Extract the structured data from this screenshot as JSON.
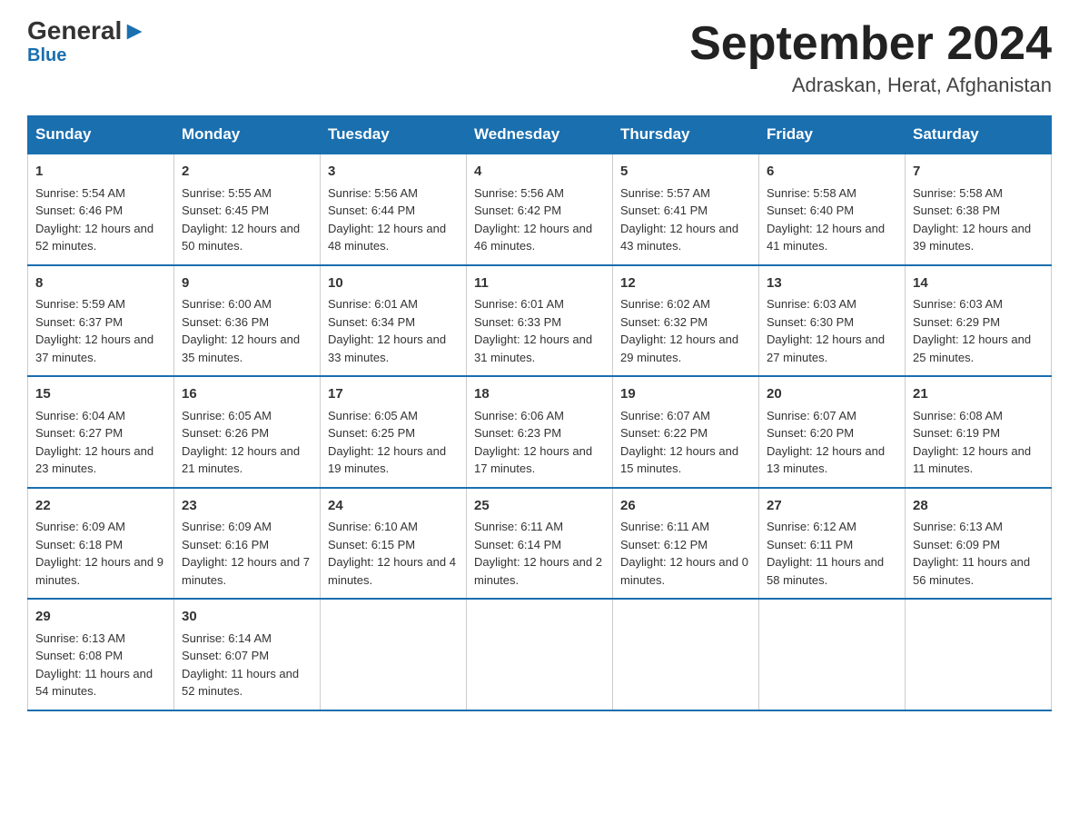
{
  "header": {
    "logo_line1_black": "General",
    "logo_line1_blue": "Blue",
    "month_title": "September 2024",
    "location": "Adraskan, Herat, Afghanistan"
  },
  "days_of_week": [
    "Sunday",
    "Monday",
    "Tuesday",
    "Wednesday",
    "Thursday",
    "Friday",
    "Saturday"
  ],
  "weeks": [
    [
      {
        "day": "1",
        "sunrise": "Sunrise: 5:54 AM",
        "sunset": "Sunset: 6:46 PM",
        "daylight": "Daylight: 12 hours and 52 minutes."
      },
      {
        "day": "2",
        "sunrise": "Sunrise: 5:55 AM",
        "sunset": "Sunset: 6:45 PM",
        "daylight": "Daylight: 12 hours and 50 minutes."
      },
      {
        "day": "3",
        "sunrise": "Sunrise: 5:56 AM",
        "sunset": "Sunset: 6:44 PM",
        "daylight": "Daylight: 12 hours and 48 minutes."
      },
      {
        "day": "4",
        "sunrise": "Sunrise: 5:56 AM",
        "sunset": "Sunset: 6:42 PM",
        "daylight": "Daylight: 12 hours and 46 minutes."
      },
      {
        "day": "5",
        "sunrise": "Sunrise: 5:57 AM",
        "sunset": "Sunset: 6:41 PM",
        "daylight": "Daylight: 12 hours and 43 minutes."
      },
      {
        "day": "6",
        "sunrise": "Sunrise: 5:58 AM",
        "sunset": "Sunset: 6:40 PM",
        "daylight": "Daylight: 12 hours and 41 minutes."
      },
      {
        "day": "7",
        "sunrise": "Sunrise: 5:58 AM",
        "sunset": "Sunset: 6:38 PM",
        "daylight": "Daylight: 12 hours and 39 minutes."
      }
    ],
    [
      {
        "day": "8",
        "sunrise": "Sunrise: 5:59 AM",
        "sunset": "Sunset: 6:37 PM",
        "daylight": "Daylight: 12 hours and 37 minutes."
      },
      {
        "day": "9",
        "sunrise": "Sunrise: 6:00 AM",
        "sunset": "Sunset: 6:36 PM",
        "daylight": "Daylight: 12 hours and 35 minutes."
      },
      {
        "day": "10",
        "sunrise": "Sunrise: 6:01 AM",
        "sunset": "Sunset: 6:34 PM",
        "daylight": "Daylight: 12 hours and 33 minutes."
      },
      {
        "day": "11",
        "sunrise": "Sunrise: 6:01 AM",
        "sunset": "Sunset: 6:33 PM",
        "daylight": "Daylight: 12 hours and 31 minutes."
      },
      {
        "day": "12",
        "sunrise": "Sunrise: 6:02 AM",
        "sunset": "Sunset: 6:32 PM",
        "daylight": "Daylight: 12 hours and 29 minutes."
      },
      {
        "day": "13",
        "sunrise": "Sunrise: 6:03 AM",
        "sunset": "Sunset: 6:30 PM",
        "daylight": "Daylight: 12 hours and 27 minutes."
      },
      {
        "day": "14",
        "sunrise": "Sunrise: 6:03 AM",
        "sunset": "Sunset: 6:29 PM",
        "daylight": "Daylight: 12 hours and 25 minutes."
      }
    ],
    [
      {
        "day": "15",
        "sunrise": "Sunrise: 6:04 AM",
        "sunset": "Sunset: 6:27 PM",
        "daylight": "Daylight: 12 hours and 23 minutes."
      },
      {
        "day": "16",
        "sunrise": "Sunrise: 6:05 AM",
        "sunset": "Sunset: 6:26 PM",
        "daylight": "Daylight: 12 hours and 21 minutes."
      },
      {
        "day": "17",
        "sunrise": "Sunrise: 6:05 AM",
        "sunset": "Sunset: 6:25 PM",
        "daylight": "Daylight: 12 hours and 19 minutes."
      },
      {
        "day": "18",
        "sunrise": "Sunrise: 6:06 AM",
        "sunset": "Sunset: 6:23 PM",
        "daylight": "Daylight: 12 hours and 17 minutes."
      },
      {
        "day": "19",
        "sunrise": "Sunrise: 6:07 AM",
        "sunset": "Sunset: 6:22 PM",
        "daylight": "Daylight: 12 hours and 15 minutes."
      },
      {
        "day": "20",
        "sunrise": "Sunrise: 6:07 AM",
        "sunset": "Sunset: 6:20 PM",
        "daylight": "Daylight: 12 hours and 13 minutes."
      },
      {
        "day": "21",
        "sunrise": "Sunrise: 6:08 AM",
        "sunset": "Sunset: 6:19 PM",
        "daylight": "Daylight: 12 hours and 11 minutes."
      }
    ],
    [
      {
        "day": "22",
        "sunrise": "Sunrise: 6:09 AM",
        "sunset": "Sunset: 6:18 PM",
        "daylight": "Daylight: 12 hours and 9 minutes."
      },
      {
        "day": "23",
        "sunrise": "Sunrise: 6:09 AM",
        "sunset": "Sunset: 6:16 PM",
        "daylight": "Daylight: 12 hours and 7 minutes."
      },
      {
        "day": "24",
        "sunrise": "Sunrise: 6:10 AM",
        "sunset": "Sunset: 6:15 PM",
        "daylight": "Daylight: 12 hours and 4 minutes."
      },
      {
        "day": "25",
        "sunrise": "Sunrise: 6:11 AM",
        "sunset": "Sunset: 6:14 PM",
        "daylight": "Daylight: 12 hours and 2 minutes."
      },
      {
        "day": "26",
        "sunrise": "Sunrise: 6:11 AM",
        "sunset": "Sunset: 6:12 PM",
        "daylight": "Daylight: 12 hours and 0 minutes."
      },
      {
        "day": "27",
        "sunrise": "Sunrise: 6:12 AM",
        "sunset": "Sunset: 6:11 PM",
        "daylight": "Daylight: 11 hours and 58 minutes."
      },
      {
        "day": "28",
        "sunrise": "Sunrise: 6:13 AM",
        "sunset": "Sunset: 6:09 PM",
        "daylight": "Daylight: 11 hours and 56 minutes."
      }
    ],
    [
      {
        "day": "29",
        "sunrise": "Sunrise: 6:13 AM",
        "sunset": "Sunset: 6:08 PM",
        "daylight": "Daylight: 11 hours and 54 minutes."
      },
      {
        "day": "30",
        "sunrise": "Sunrise: 6:14 AM",
        "sunset": "Sunset: 6:07 PM",
        "daylight": "Daylight: 11 hours and 52 minutes."
      },
      null,
      null,
      null,
      null,
      null
    ]
  ]
}
